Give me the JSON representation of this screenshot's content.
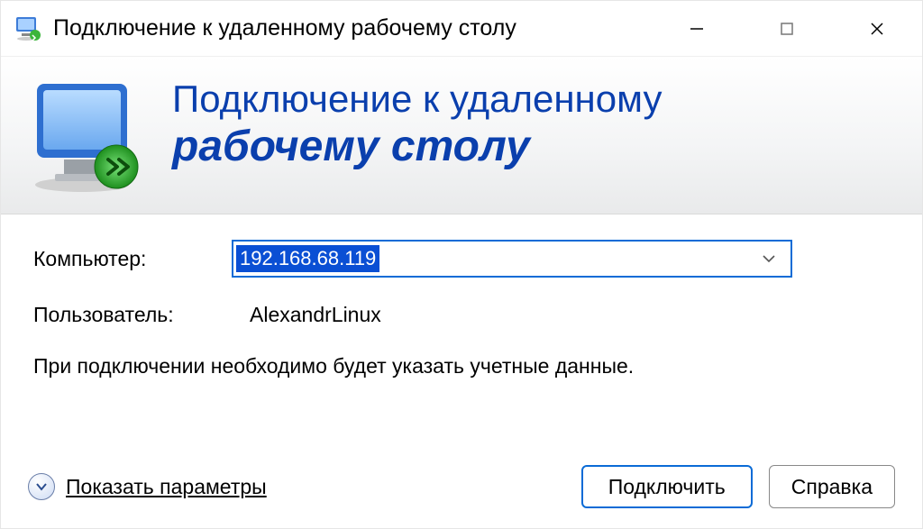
{
  "window": {
    "title": "Подключение к удаленному рабочему столу"
  },
  "header": {
    "line1": "Подключение к удаленному",
    "line2": "рабочему столу"
  },
  "body": {
    "computer_label": "Компьютер:",
    "computer_value": "192.168.68.119",
    "user_label": "Пользователь:",
    "user_value": "AlexandrLinux",
    "info_text": "При подключении необходимо будет указать учетные данные."
  },
  "footer": {
    "expand_label": "Показать параметры",
    "connect_label": "Подключить",
    "help_label": "Справка"
  }
}
